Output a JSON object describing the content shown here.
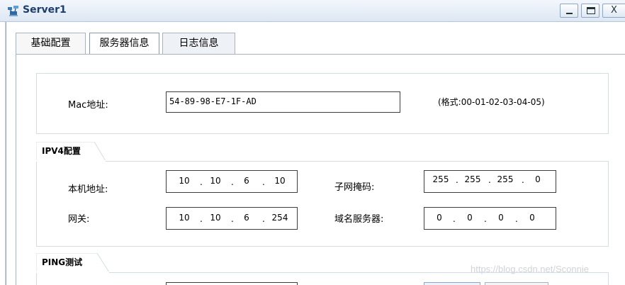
{
  "window": {
    "title": "Server1",
    "icon": "server-icon",
    "close_glyph": "X"
  },
  "tabs": [
    {
      "label": "基础配置"
    },
    {
      "label": "服务器信息",
      "active": true
    },
    {
      "label": "日志信息"
    }
  ],
  "mac": {
    "label": "Mac地址:",
    "value": "54-89-98-E7-1F-AD",
    "hint": "(格式:00-01-02-03-04-05)"
  },
  "ipv4": {
    "title": "IPV4配置",
    "local_address": {
      "label": "本机地址:",
      "octets": [
        "10",
        "10",
        "6",
        "10"
      ]
    },
    "subnet_mask": {
      "label": "子网掩码:",
      "octets": [
        "255",
        "255",
        "255",
        "0"
      ]
    },
    "gateway": {
      "label": "网关:",
      "octets": [
        "10",
        "10",
        "6",
        "254"
      ]
    },
    "dns_server": {
      "label": "域名服务器:",
      "octets": [
        "0",
        "0",
        "0",
        "0"
      ]
    }
  },
  "ping": {
    "title": "PING测试"
  },
  "watermark": "https://blog.csdn.net/Sconnie",
  "colors": {
    "title_text": "#1c3d6e",
    "titlebar_top": "#f3f7fc",
    "titlebar_bottom": "#dde7f3",
    "tab_border": "#a9b3bf",
    "group_border": "#d6dce3"
  }
}
